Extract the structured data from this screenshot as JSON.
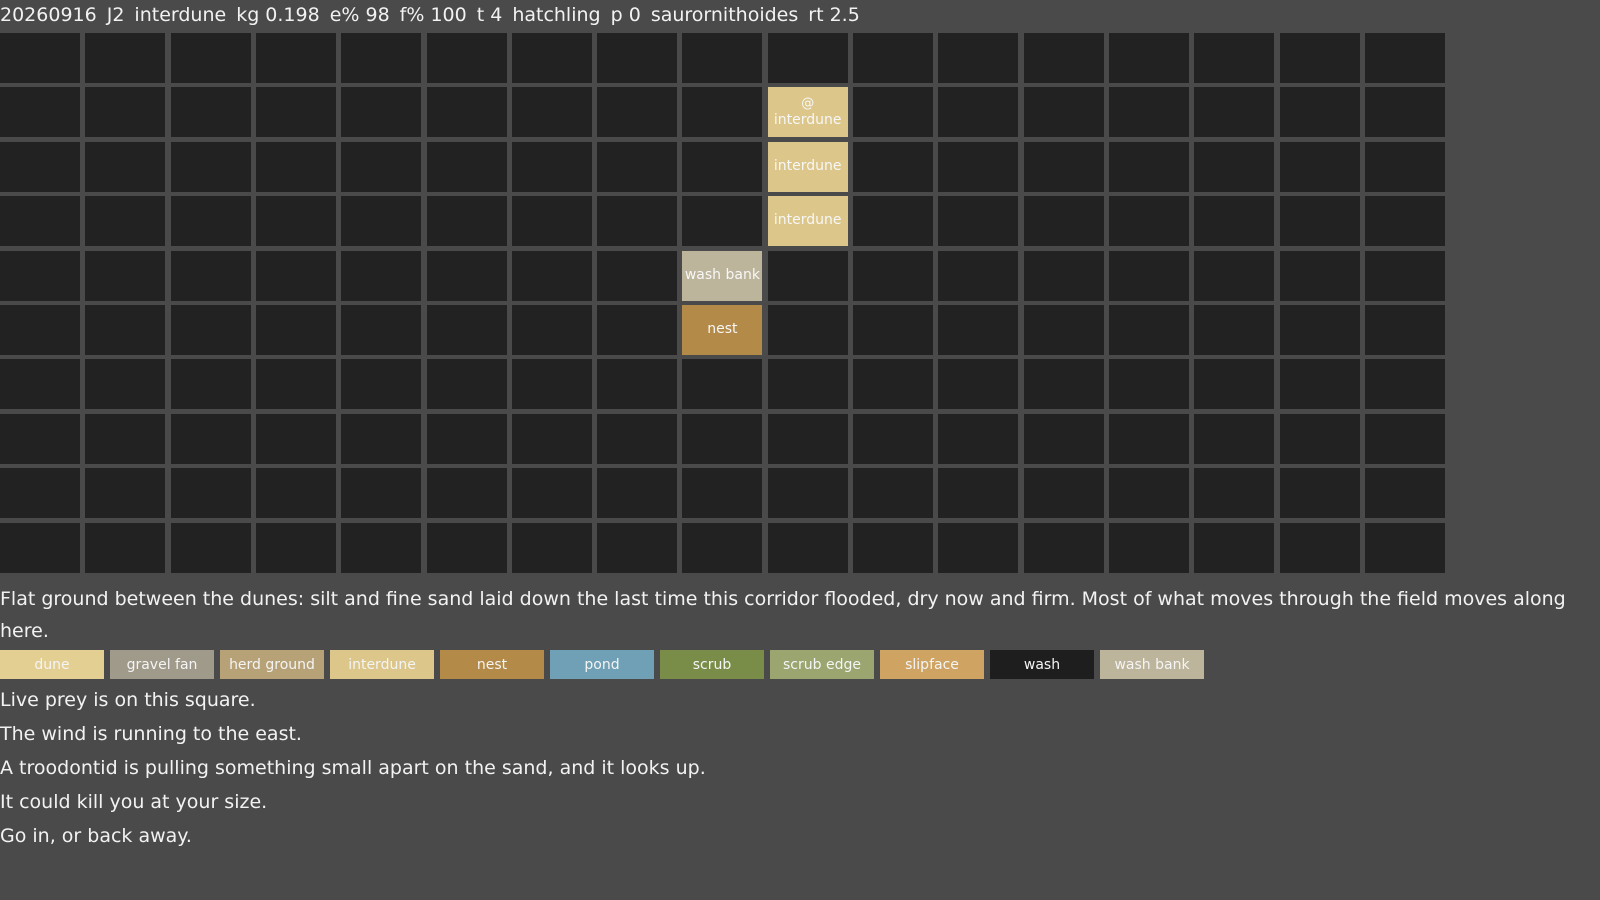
{
  "status": {
    "date": "20260916",
    "code": "J2",
    "terrain": "interdune",
    "kg": "kg 0.198",
    "energy": "e% 98",
    "food": "f% 100",
    "turn": "t 4",
    "stage": "hatchling",
    "p": "p 0",
    "species": "saurornithoides",
    "rt": "rt 2.5"
  },
  "grid": {
    "cols": 17,
    "rows": 10,
    "empty_color": "#222222",
    "player_marker": "@",
    "revealed": [
      {
        "col": 9,
        "row": 1,
        "terrain": "interdune",
        "player": true
      },
      {
        "col": 9,
        "row": 2,
        "terrain": "interdune",
        "player": false
      },
      {
        "col": 9,
        "row": 3,
        "terrain": "interdune",
        "player": false
      },
      {
        "col": 8,
        "row": 4,
        "terrain": "wash bank",
        "player": false
      },
      {
        "col": 8,
        "row": 5,
        "terrain": "nest",
        "player": false
      }
    ]
  },
  "description": "Flat ground between the dunes: silt and fine sand laid down the last time this corridor flooded, dry now and firm. Most of what moves through the field moves along here.",
  "legend": [
    {
      "label": "dune",
      "color": "#e4cf93"
    },
    {
      "label": "gravel fan",
      "color": "#a09a8a"
    },
    {
      "label": "herd ground",
      "color": "#b7a277"
    },
    {
      "label": "interdune",
      "color": "#dcc68a"
    },
    {
      "label": "nest",
      "color": "#b38a48"
    },
    {
      "label": "pond",
      "color": "#6fa0b5"
    },
    {
      "label": "scrub",
      "color": "#798c48"
    },
    {
      "label": "scrub edge",
      "color": "#9aa56f"
    },
    {
      "label": "slipface",
      "color": "#cfa463"
    },
    {
      "label": "wash",
      "color": "#1e1e1e"
    },
    {
      "label": "wash bank",
      "color": "#bdb49c"
    }
  ],
  "messages": [
    "Live prey is on this square.",
    "The wind is running to the east.",
    "A troodontid is pulling something small apart on the sand, and it looks up.",
    "It could kill you at your size.",
    "Go in, or back away."
  ]
}
